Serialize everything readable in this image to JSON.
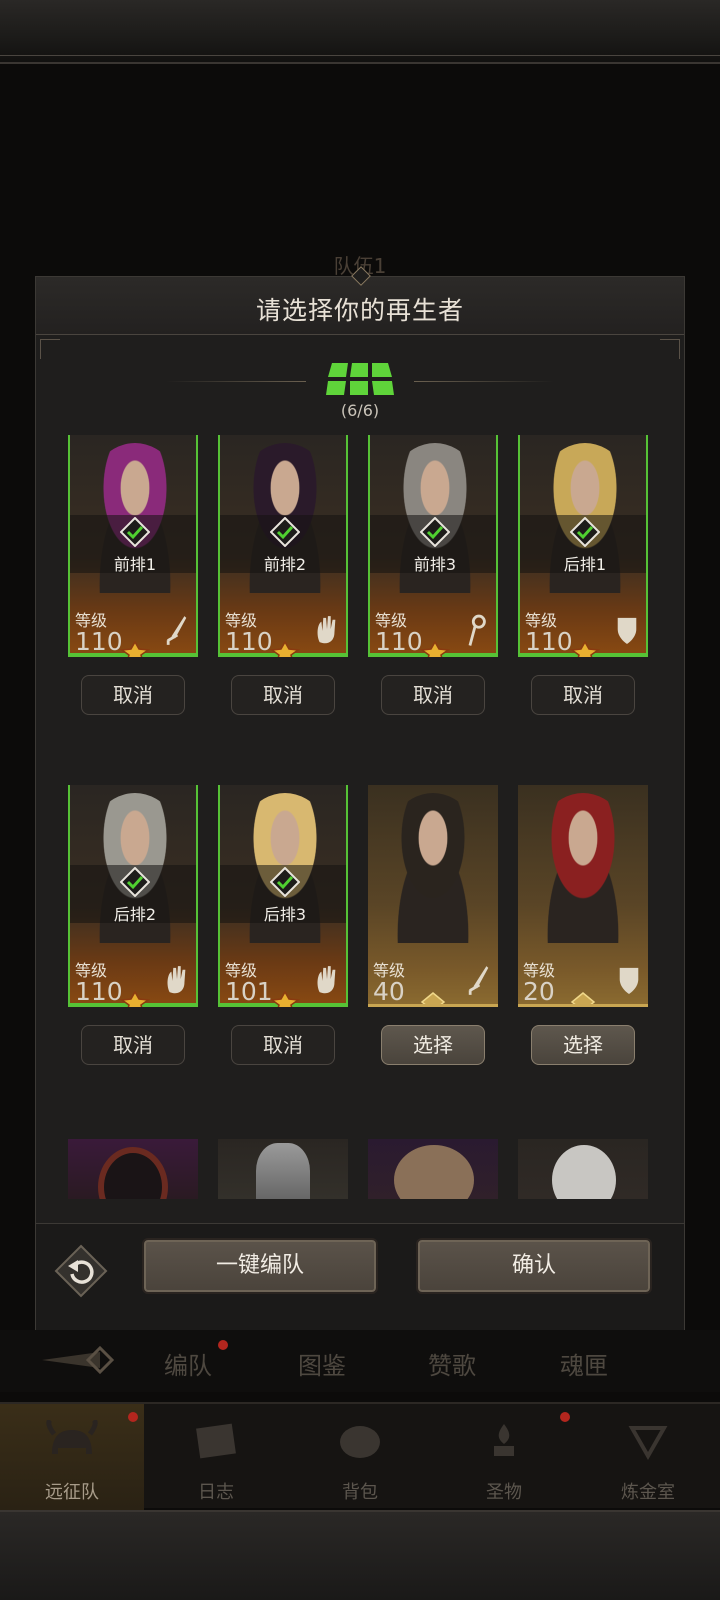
{
  "background": {
    "team_title": "队伍1"
  },
  "modal": {
    "title": "请选择你的再生者",
    "count": "(6/6)",
    "heroes": [
      {
        "slot": "前排1",
        "level_label": "等级",
        "level": "110",
        "class_icon": "sword-icon",
        "selected": true,
        "button": "取消",
        "hair": "#8a2a7a"
      },
      {
        "slot": "前排2",
        "level_label": "等级",
        "level": "110",
        "class_icon": "hand-icon",
        "selected": true,
        "button": "取消",
        "hair": "#2a1a2a"
      },
      {
        "slot": "前排3",
        "level_label": "等级",
        "level": "110",
        "class_icon": "staff-icon",
        "selected": true,
        "button": "取消",
        "hair": "#8a8680"
      },
      {
        "slot": "后排1",
        "level_label": "等级",
        "level": "110",
        "class_icon": "shield-icon",
        "selected": true,
        "button": "取消",
        "hair": "#c8a858"
      },
      {
        "slot": "后排2",
        "level_label": "等级",
        "level": "110",
        "class_icon": "hand-icon",
        "selected": true,
        "button": "取消",
        "hair": "#9a9890"
      },
      {
        "slot": "后排3",
        "level_label": "等级",
        "level": "101",
        "class_icon": "hand-icon",
        "selected": true,
        "button": "取消",
        "hair": "#d8b870"
      },
      {
        "slot": "",
        "level_label": "等级",
        "level": "40",
        "class_icon": "sword-icon",
        "selected": false,
        "button": "选择",
        "hair": "#2a241e"
      },
      {
        "slot": "",
        "level_label": "等级",
        "level": "20",
        "class_icon": "shield-icon",
        "selected": false,
        "button": "选择",
        "hair": "#8a2020"
      }
    ],
    "auto_button": "一键编队",
    "confirm_button": "确认"
  },
  "subtabs": [
    "编队",
    "图鉴",
    "赞歌",
    "魂匣"
  ],
  "nav": [
    {
      "label": "远征队",
      "icon": "helmet-icon",
      "active": true,
      "dot": true
    },
    {
      "label": "日志",
      "icon": "scroll-icon",
      "active": false,
      "dot": false
    },
    {
      "label": "背包",
      "icon": "bag-icon",
      "active": false,
      "dot": false
    },
    {
      "label": "圣物",
      "icon": "torch-icon",
      "active": false,
      "dot": true
    },
    {
      "label": "炼金室",
      "icon": "alchemy-icon",
      "active": false,
      "dot": false
    }
  ]
}
